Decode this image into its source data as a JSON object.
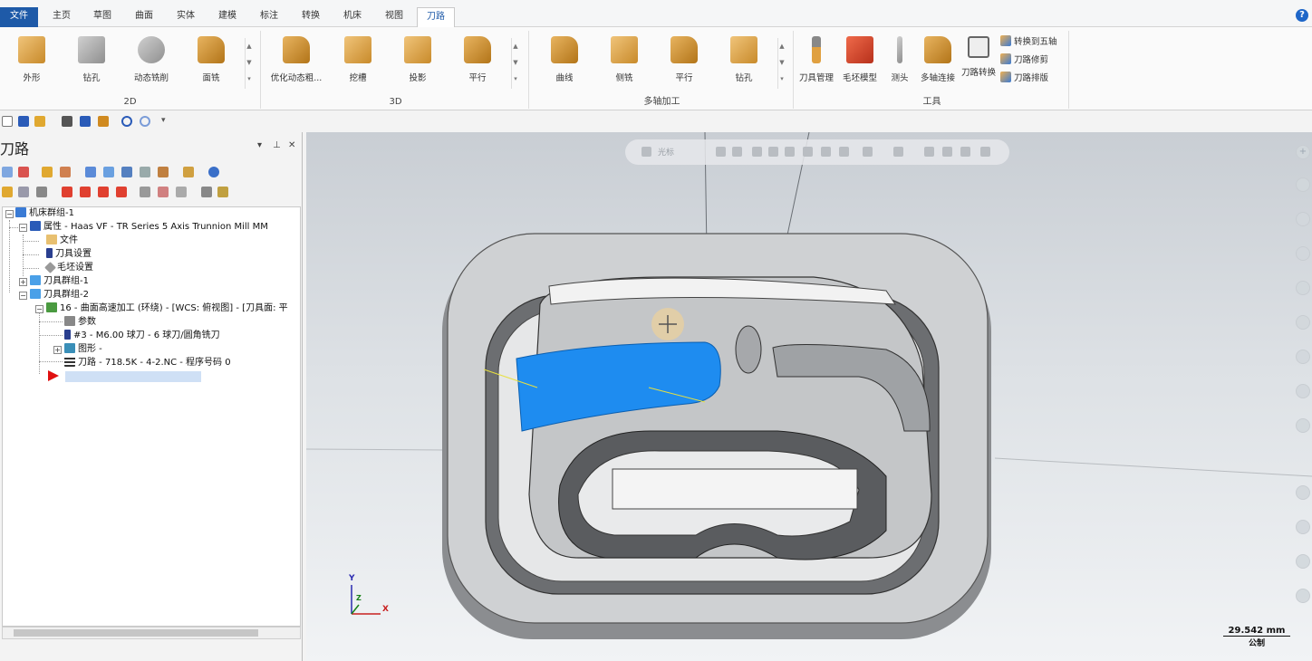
{
  "menu": {
    "tabs": [
      "文件",
      "主页",
      "草图",
      "曲面",
      "实体",
      "建模",
      "标注",
      "转换",
      "机床",
      "视图",
      "刀路"
    ],
    "active": "刀路"
  },
  "ribbon": {
    "group_2d": {
      "label": "2D",
      "buttons": [
        "外形",
        "钻孔",
        "动态铣削",
        "面铣"
      ]
    },
    "group_3d": {
      "label": "3D",
      "buttons": [
        "优化动态粗...",
        "挖槽",
        "投影",
        "平行"
      ]
    },
    "group_multi": {
      "label": "多轴加工",
      "buttons": [
        "曲线",
        "侧铣",
        "平行",
        "钻孔"
      ]
    },
    "group_tools": {
      "label": "工具",
      "buttons": [
        "刀具管理",
        "毛坯模型",
        "测头",
        "多轴连接",
        "刀路转换"
      ],
      "small": [
        "转换到五轴",
        "刀路修剪",
        "刀路排版"
      ]
    }
  },
  "panel": {
    "title": "刀路",
    "tree": {
      "root": "机床群组-1",
      "properties": "属性 - Haas VF - TR Series 5 Axis Trunnion Mill MM",
      "files": "文件",
      "tool_settings": "刀具设置",
      "stock_settings": "毛坯设置",
      "tool_group_1": "刀具群组-1",
      "tool_group_2": "刀具群组-2",
      "operation": "16 - 曲面高速加工 (环绕) - [WCS: 俯视图] - [刀具面: 平",
      "params": "参数",
      "tool": "#3 - M6.00 球刀 - 6 球刀/圆角铣刀",
      "geometry": "图形 -",
      "toolpath": "刀路 - 718.5K - 4-2.NC - 程序号码 0"
    }
  },
  "viewport": {
    "toolbar_label": "光标",
    "scale_value": "29.542 mm",
    "scale_unit": "公制",
    "axes": {
      "x": "X",
      "y": "Y",
      "z": "Z"
    }
  },
  "colors": {
    "accent": "#1e5aa8",
    "selection": "#1e8cf0"
  }
}
